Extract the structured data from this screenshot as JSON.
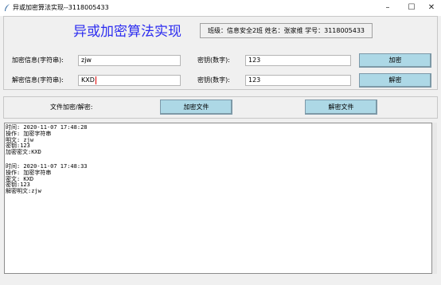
{
  "window": {
    "title": "异或加密算法实现--3118005433",
    "minimize": "–",
    "maximize": "☐",
    "close": "✕",
    "icon": "feather-icon"
  },
  "header": {
    "title": "异或加密算法实现",
    "info": "班级：信息安全2班   姓名：张家维 学号：3118005433"
  },
  "encrypt": {
    "label": "加密信息(字符串):",
    "value": "zjw",
    "key_label": "密钥(数字):",
    "key_value": "123",
    "button": "加密"
  },
  "decrypt": {
    "label": "解密信息(字符串):",
    "value": "KXD",
    "key_label": "密钥(数字):",
    "key_value": "123",
    "button": "解密"
  },
  "files": {
    "label": "文件加密/解密:",
    "encrypt_button": "加密文件",
    "decrypt_button": "解密文件"
  },
  "log": {
    "entries": [
      {
        "time": "时间: 2020-11-07 17:48:28",
        "op": "操作: 加密字符串",
        "input": "明文: zjw",
        "key": "密钥:123",
        "output": "加密密文:KXD"
      },
      {
        "time": "时间: 2020-11-07 17:48:33",
        "op": "操作: 加密字符串",
        "input": "密文: KXD",
        "key": "密钥:123",
        "output": "解密明文:zjw"
      }
    ]
  }
}
